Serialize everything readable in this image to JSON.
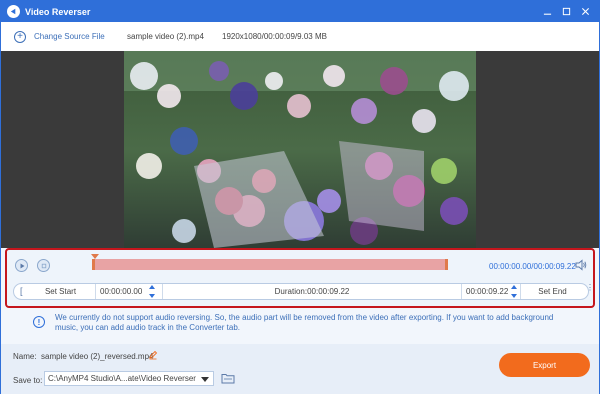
{
  "window": {
    "title": "Video Reverser"
  },
  "toolbar": {
    "change_source_label": "Change Source File",
    "file_name": "sample video (2).mp4",
    "file_meta": "1920x1080/00:00:09/9.03 MB"
  },
  "player": {
    "time_current": "00:00:00.00",
    "time_total": "00:00:09.22",
    "progress": 0.0
  },
  "trim": {
    "set_start_label": "Set Start",
    "start_time": "00:00:00.00",
    "duration": "Duration:00:00:09.22",
    "end_time": "00:00:09.22",
    "set_end_label": "Set End"
  },
  "notice": {
    "text": "We currently do not support audio reversing. So, the audio part will be removed from the video after exporting. If you want to add background music, you can add audio track in the Converter tab."
  },
  "output": {
    "name_label": "Name:",
    "name_value": "sample video (2)_reversed.mp4",
    "save_to_label": "Save to:",
    "save_to_path": "C:\\AnyMP4 Studio\\A...ate\\Video Reverser",
    "export_label": "Export"
  },
  "colors": {
    "title_bar": "#2f6fd9",
    "accent_blue": "#3c6fb8",
    "highlight_border": "#c5161d",
    "timeline_fill": "#e8a3a4",
    "export_button": "#f26b1d"
  },
  "icons": [
    "app-icon",
    "minimize-icon",
    "maximize-icon",
    "close-icon",
    "plus-circle-icon",
    "play-icon",
    "stop-icon",
    "volume-icon",
    "info-icon",
    "edit-icon",
    "dropdown-arrow-icon",
    "folder-icon"
  ]
}
